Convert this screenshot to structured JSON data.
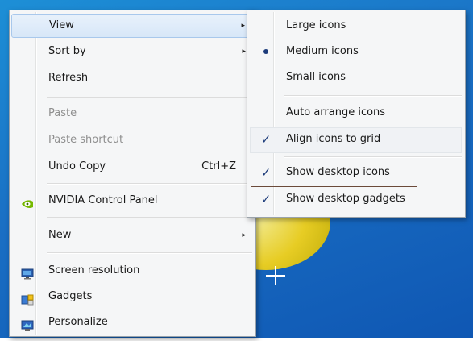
{
  "context_menu": {
    "items": [
      {
        "label": "View",
        "submenu": true
      },
      {
        "label": "Sort by",
        "submenu": true
      },
      {
        "label": "Refresh"
      },
      {
        "label": "Paste",
        "disabled": true
      },
      {
        "label": "Paste shortcut",
        "disabled": true
      },
      {
        "label": "Undo Copy",
        "shortcut": "Ctrl+Z"
      },
      {
        "label": "NVIDIA Control Panel",
        "icon": "nvidia-icon"
      },
      {
        "label": "New",
        "submenu": true
      },
      {
        "label": "Screen resolution",
        "icon": "monitor-icon"
      },
      {
        "label": "Gadgets",
        "icon": "gadgets-icon"
      },
      {
        "label": "Personalize",
        "icon": "personalize-icon"
      }
    ]
  },
  "view_submenu": {
    "items": [
      {
        "label": "Large icons"
      },
      {
        "label": "Medium icons",
        "state": "radio-selected"
      },
      {
        "label": "Small icons"
      },
      {
        "label": "Auto arrange icons"
      },
      {
        "label": "Align icons to grid",
        "state": "checked"
      },
      {
        "label": "Show desktop icons",
        "state": "checked"
      },
      {
        "label": "Show desktop gadgets",
        "state": "checked"
      }
    ]
  },
  "glyphs": {
    "arrow": "▸",
    "check": "✓"
  },
  "colors": {
    "desktop_blue": "#1a6fc4",
    "menu_bg": "#f5f6f7",
    "nvidia_green": "#76b900",
    "check_blue": "#1c3b7a"
  }
}
